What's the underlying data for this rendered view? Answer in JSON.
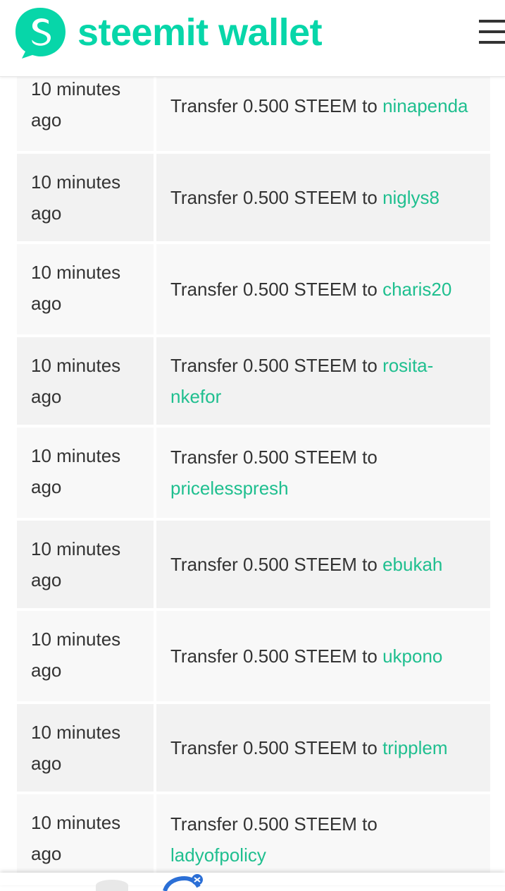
{
  "header": {
    "logo_text": "steemit wallet",
    "brand_color": "#07d6a9",
    "menu_icon": "hamburger-menu-icon"
  },
  "transfers": [
    {
      "time": "10 minutes ago",
      "prefix": "Transfer 0.500 STEEM to",
      "user": "ninapenda"
    },
    {
      "time": "10 minutes ago",
      "prefix": "Transfer 0.500 STEEM to",
      "user": "niglys8"
    },
    {
      "time": "10 minutes ago",
      "prefix": "Transfer 0.500 STEEM to",
      "user": "charis20"
    },
    {
      "time": "10 minutes ago",
      "prefix": "Transfer 0.500 STEEM to",
      "user": "rosita-nkefor"
    },
    {
      "time": "10 minutes ago",
      "prefix": "Transfer 0.500 STEEM to",
      "user": "pricelesspresh"
    },
    {
      "time": "10 minutes ago",
      "prefix": "Transfer 0.500 STEEM to",
      "user": "ebukah"
    },
    {
      "time": "10 minutes ago",
      "prefix": "Transfer 0.500 STEEM to",
      "user": "ukpono"
    },
    {
      "time": "10 minutes ago",
      "prefix": "Transfer 0.500 STEEM to",
      "user": "tripplem"
    },
    {
      "time": "10 minutes ago",
      "prefix": "Transfer 0.500 STEEM to",
      "user": "ladyofpolicy"
    }
  ],
  "link_color": "#1fbf8f"
}
